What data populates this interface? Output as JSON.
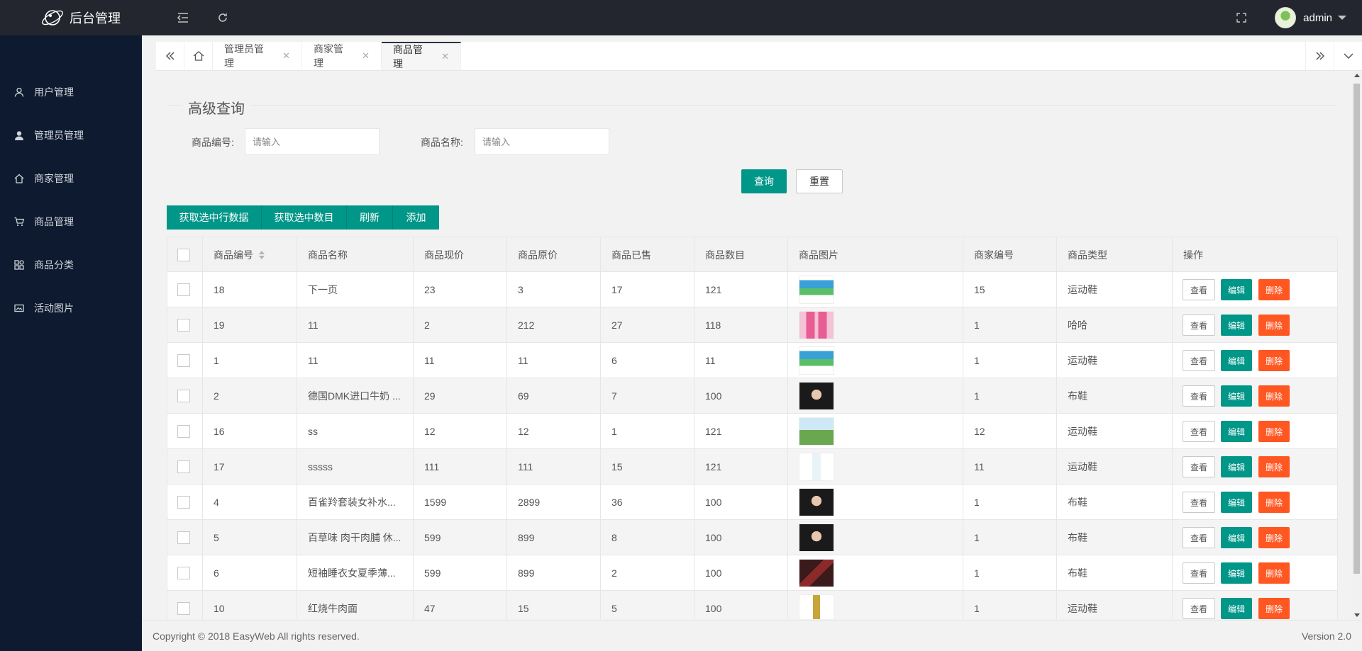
{
  "header": {
    "app_title": "后台管理",
    "username": "admin"
  },
  "sidebar": {
    "items": [
      {
        "label": "用户管理",
        "icon": "user-icon"
      },
      {
        "label": "管理员管理",
        "icon": "admin-user-icon"
      },
      {
        "label": "商家管理",
        "icon": "home-icon"
      },
      {
        "label": "商品管理",
        "icon": "cart-icon"
      },
      {
        "label": "商品分类",
        "icon": "category-icon"
      },
      {
        "label": "活动图片",
        "icon": "picture-icon"
      }
    ]
  },
  "tabs": [
    {
      "label": "管理员管理",
      "active": false
    },
    {
      "label": "商家管理",
      "active": false
    },
    {
      "label": "商品管理",
      "active": true
    }
  ],
  "search": {
    "legend": "高级查询",
    "code_label": "商品编号:",
    "code_placeholder": "请输入",
    "name_label": "商品名称:",
    "name_placeholder": "请输入",
    "query_button": "查询",
    "reset_button": "重置"
  },
  "toolbar": {
    "get_rows": "获取选中行数据",
    "get_count": "获取选中数目",
    "refresh": "刷新",
    "add": "添加"
  },
  "table": {
    "columns": [
      "商品编号",
      "商品名称",
      "商品现价",
      "商品原价",
      "商品已售",
      "商品数目",
      "商品图片",
      "商家编号",
      "商品类型",
      "操作"
    ],
    "actions": {
      "view": "查看",
      "edit": "编辑",
      "delete": "删除"
    },
    "rows": [
      {
        "id": "18",
        "name": "下一页",
        "price": "23",
        "orig": "3",
        "sold": "17",
        "stock": "121",
        "img": "milk-box",
        "shop": "15",
        "type": "运动鞋"
      },
      {
        "id": "19",
        "name": "11",
        "price": "2",
        "orig": "212",
        "sold": "27",
        "stock": "118",
        "img": "pink-bottles",
        "shop": "1",
        "type": "哈哈"
      },
      {
        "id": "1",
        "name": "11",
        "price": "11",
        "orig": "11",
        "sold": "6",
        "stock": "11",
        "img": "milk-box",
        "shop": "1",
        "type": "运动鞋"
      },
      {
        "id": "2",
        "name": "德国DMK进口牛奶 ...",
        "price": "29",
        "orig": "69",
        "sold": "7",
        "stock": "100",
        "img": "portrait",
        "shop": "1",
        "type": "布鞋"
      },
      {
        "id": "16",
        "name": "ss",
        "price": "12",
        "orig": "12",
        "sold": "1",
        "stock": "121",
        "img": "landscape",
        "shop": "12",
        "type": "运动鞋"
      },
      {
        "id": "17",
        "name": "sssss",
        "price": "111",
        "orig": "111",
        "sold": "15",
        "stock": "121",
        "img": "water-bottle",
        "shop": "11",
        "type": "运动鞋"
      },
      {
        "id": "4",
        "name": "百雀羚套装女补水...",
        "price": "1599",
        "orig": "2899",
        "sold": "36",
        "stock": "100",
        "img": "portrait",
        "shop": "1",
        "type": "布鞋"
      },
      {
        "id": "5",
        "name": "百草味 肉干肉脯 休...",
        "price": "599",
        "orig": "899",
        "sold": "8",
        "stock": "100",
        "img": "portrait",
        "shop": "1",
        "type": "布鞋"
      },
      {
        "id": "6",
        "name": "短袖睡衣女夏季薄...",
        "price": "599",
        "orig": "899",
        "sold": "2",
        "stock": "100",
        "img": "dark-red",
        "shop": "1",
        "type": "布鞋"
      },
      {
        "id": "10",
        "name": "红烧牛肉面",
        "price": "47",
        "orig": "15",
        "sold": "5",
        "stock": "100",
        "img": "tea-bottle",
        "shop": "1",
        "type": "运动鞋"
      }
    ]
  },
  "footer": {
    "copyright": "Copyright © 2018 EasyWeb All rights reserved.",
    "version": "Version 2.0"
  },
  "colors": {
    "primary": "#009688",
    "danger": "#ff5722",
    "header": "#23262e",
    "sidebar": "#0d1a2f"
  }
}
